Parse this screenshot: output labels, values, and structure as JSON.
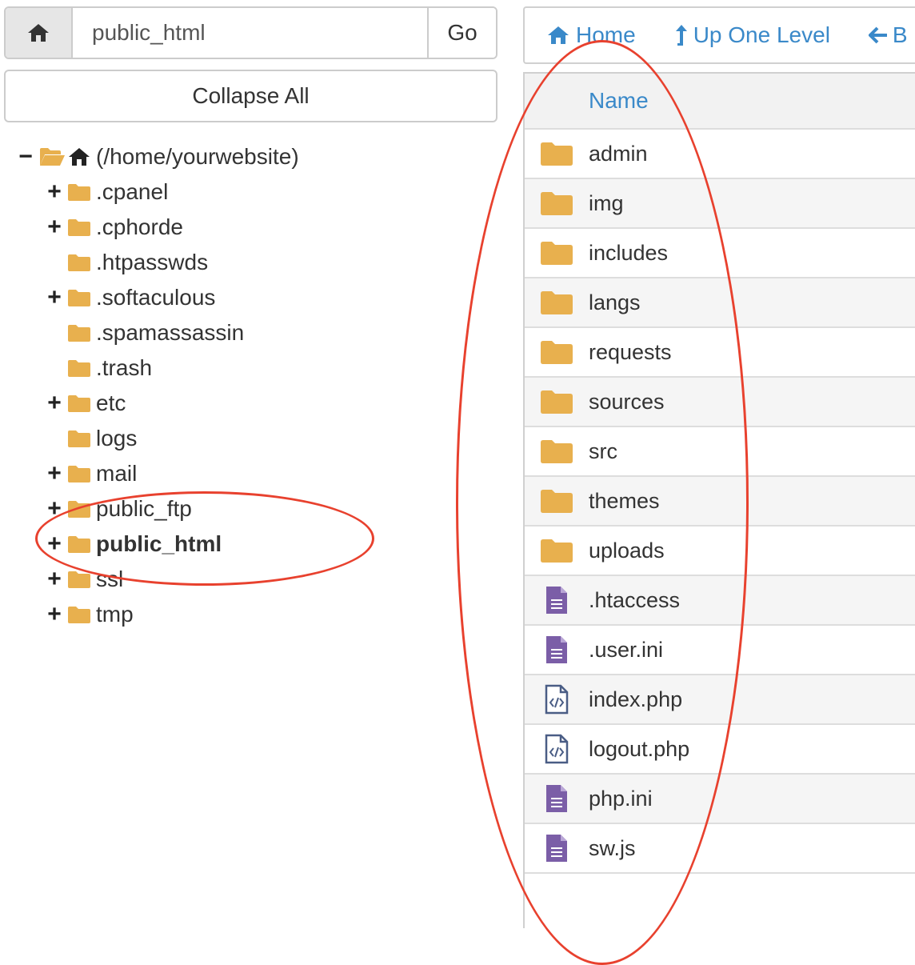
{
  "path_bar": {
    "home_icon": "home-icon",
    "value": "public_html",
    "go_label": "Go"
  },
  "collapse_label": "Collapse All",
  "tree": {
    "root": {
      "toggle": "−",
      "label": "(/home/yourwebsite)"
    },
    "items": [
      {
        "toggle": "+",
        "label": ".cpanel",
        "bold": false
      },
      {
        "toggle": "+",
        "label": ".cphorde",
        "bold": false
      },
      {
        "toggle": "",
        "label": ".htpasswds",
        "bold": false
      },
      {
        "toggle": "+",
        "label": ".softaculous",
        "bold": false
      },
      {
        "toggle": "",
        "label": ".spamassassin",
        "bold": false
      },
      {
        "toggle": "",
        "label": ".trash",
        "bold": false
      },
      {
        "toggle": "+",
        "label": "etc",
        "bold": false
      },
      {
        "toggle": "",
        "label": "logs",
        "bold": false
      },
      {
        "toggle": "+",
        "label": "mail",
        "bold": false
      },
      {
        "toggle": "+",
        "label": "public_ftp",
        "bold": false
      },
      {
        "toggle": "+",
        "label": "public_html",
        "bold": true
      },
      {
        "toggle": "+",
        "label": "ssl",
        "bold": false
      },
      {
        "toggle": "+",
        "label": "tmp",
        "bold": false
      }
    ]
  },
  "toolbar": {
    "home_label": "Home",
    "up_label": "Up One Level",
    "back_label": "B"
  },
  "file_list": {
    "header": "Name",
    "files": [
      {
        "name": "admin",
        "type": "folder"
      },
      {
        "name": "img",
        "type": "folder"
      },
      {
        "name": "includes",
        "type": "folder"
      },
      {
        "name": "langs",
        "type": "folder"
      },
      {
        "name": "requests",
        "type": "folder"
      },
      {
        "name": "sources",
        "type": "folder"
      },
      {
        "name": "src",
        "type": "folder"
      },
      {
        "name": "themes",
        "type": "folder"
      },
      {
        "name": "uploads",
        "type": "folder"
      },
      {
        "name": ".htaccess",
        "type": "text"
      },
      {
        "name": ".user.ini",
        "type": "text"
      },
      {
        "name": "index.php",
        "type": "code"
      },
      {
        "name": "logout.php",
        "type": "code"
      },
      {
        "name": "php.ini",
        "type": "text"
      },
      {
        "name": "sw.js",
        "type": "text"
      }
    ]
  },
  "colors": {
    "folder": "#e8b04e",
    "text_file": "#7b5ea7",
    "code_file": "#4a5d85",
    "link": "#3a89c9",
    "annotation": "#e8412e"
  }
}
